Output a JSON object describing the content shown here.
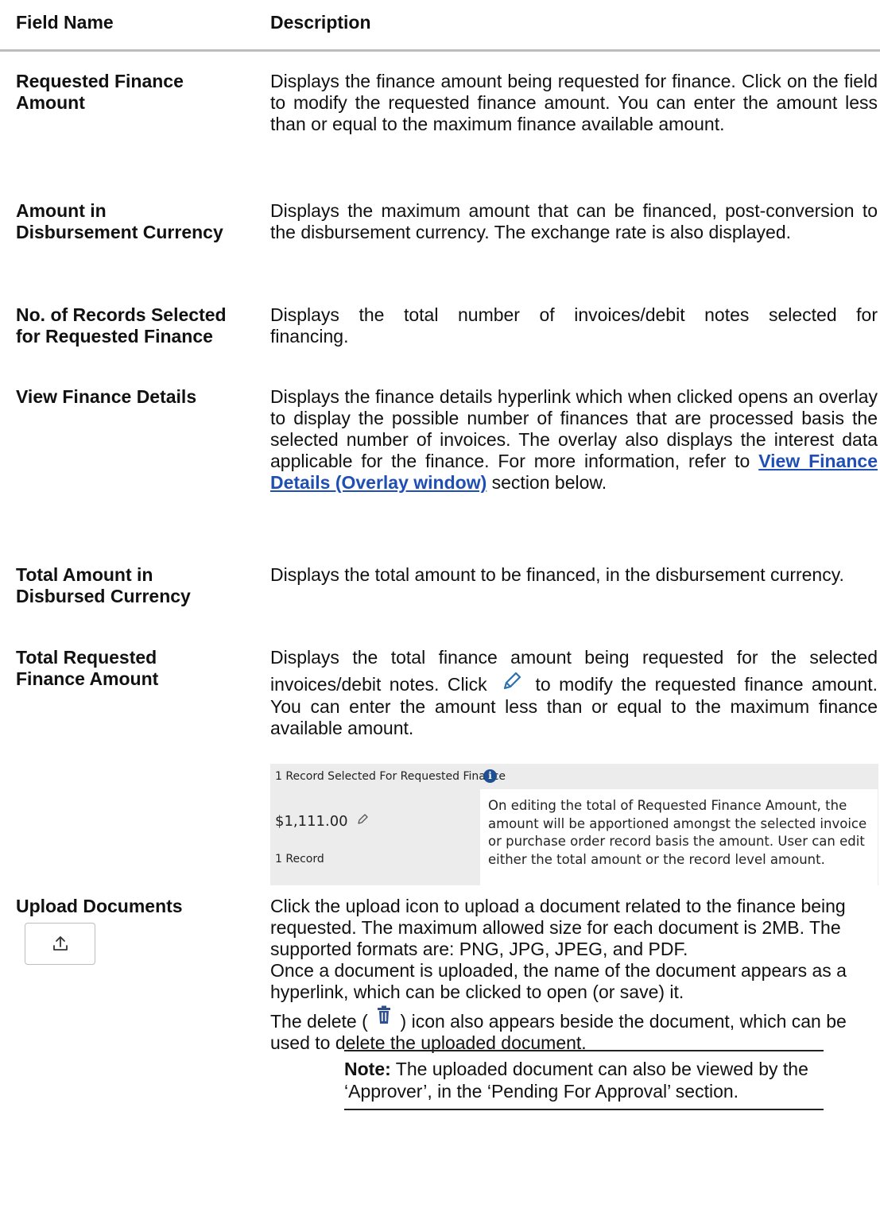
{
  "table": {
    "header_field": "Field Name",
    "header_desc": "Description"
  },
  "rows": {
    "rfa": {
      "name": "Requested Finance Amount",
      "desc": "Displays the finance amount being requested for finance. Click on the field to modify the requested finance amount. You can enter the amount less than or equal to the maximum finance available amount."
    },
    "adc": {
      "name_line1": "Amount in",
      "name_line2": "Disbursement Currency",
      "desc": "Displays the maximum amount that can be financed, post-conversion to the disbursement currency. The exchange rate is also displayed."
    },
    "nrs": {
      "name_line1": "No. of Records Selected",
      "name_line2": "for Requested Finance",
      "desc_line1": "Displays the total number of invoices/debit notes selected for",
      "desc_line2": "financing."
    },
    "vfd": {
      "name": "View Finance Details",
      "desc_pre": "Displays the finance details hyperlink which when clicked opens an overlay to display the possible number of finances that are processed basis the selected number of invoices. The overlay also displays the interest data applicable for the finance. For more information, refer to",
      "link": "View Finance Details (Overlay window)",
      "desc_post": "section below."
    },
    "tadc": {
      "name_line1": "Total Amount in",
      "name_line2": "Disbursed Currency",
      "desc": "Displays the total amount to be financed, in the disbursement currency."
    },
    "trfa": {
      "name_line1": "Total Requested",
      "name_line2": "Finance Amount",
      "desc_line1": "Displays the total finance amount being requested for the selected",
      "desc_pre": "invoices/debit notes. Click",
      "desc_post": "to modify the requested finance amount. You can enter the amount less than or equal to the maximum finance available amount."
    },
    "upload": {
      "name": "Upload Documents",
      "desc1": "Click the upload icon to upload a document related to the finance being requested. The maximum allowed size for each document is 2MB. The supported formats are: PNG, JPG, JPEG, and PDF.",
      "desc2": "Once a document is uploaded, the name of the document appears as a hyperlink, which can be clicked to open (or save) it.",
      "desc3_pre": "The delete (",
      "desc3_post": ") icon also appears beside the document, which can be used to delete the uploaded document."
    }
  },
  "screenshot": {
    "selected_label": "1 Record Selected For Requested Finance",
    "amount": "$1,111.00",
    "records": "1 Record",
    "tooltip": "On editing the total of Requested Finance Amount, the amount will be apportioned amongst the selected invoice or purchase order record basis the amount. User can edit either the total amount or the record level amount."
  },
  "note": {
    "label": "Note:",
    "text": "The uploaded document can also be viewed by the ‘Approver’, in the ‘Pending For Approval’ section."
  },
  "icons": {
    "edit": "pencil-icon",
    "upload": "upload-icon",
    "delete": "trash-icon",
    "info": "info-icon"
  }
}
